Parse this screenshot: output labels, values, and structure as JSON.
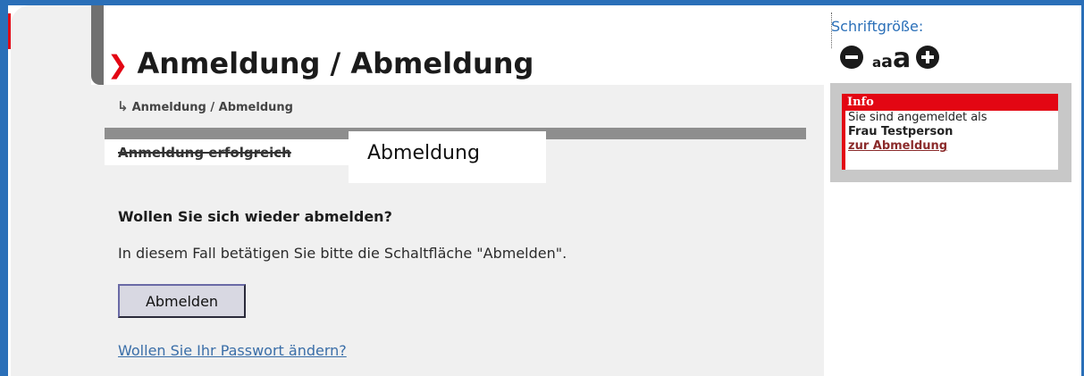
{
  "page": {
    "title": "Anmeldung / Abmeldung",
    "breadcrumb": "Anmeldung / Abmeldung"
  },
  "tabs": {
    "done_label": "Anmeldung erfolgreich",
    "active_label": "Abmeldung"
  },
  "main": {
    "question": "Wollen Sie sich wieder abmelden?",
    "hint": "In diesem Fall betätigen Sie bitte die Schaltfläche \"Abmelden\".",
    "logout_button": "Abmelden",
    "password_link": "Wollen Sie Ihr Passwort ändern?"
  },
  "font_size": {
    "label": "Schriftgröße:",
    "small": "a",
    "medium": "a",
    "large": "a",
    "decrease_icon": "minus-circle-icon",
    "increase_icon": "plus-circle-icon"
  },
  "info": {
    "header": "Info",
    "line1": "Sie sind angemeldet als",
    "name": "Frau Testperson",
    "logout_link": "zur Abmeldung"
  },
  "colors": {
    "accent_red": "#e30613",
    "frame_blue": "#2a6fb8",
    "link_blue": "#3a6ea8"
  }
}
